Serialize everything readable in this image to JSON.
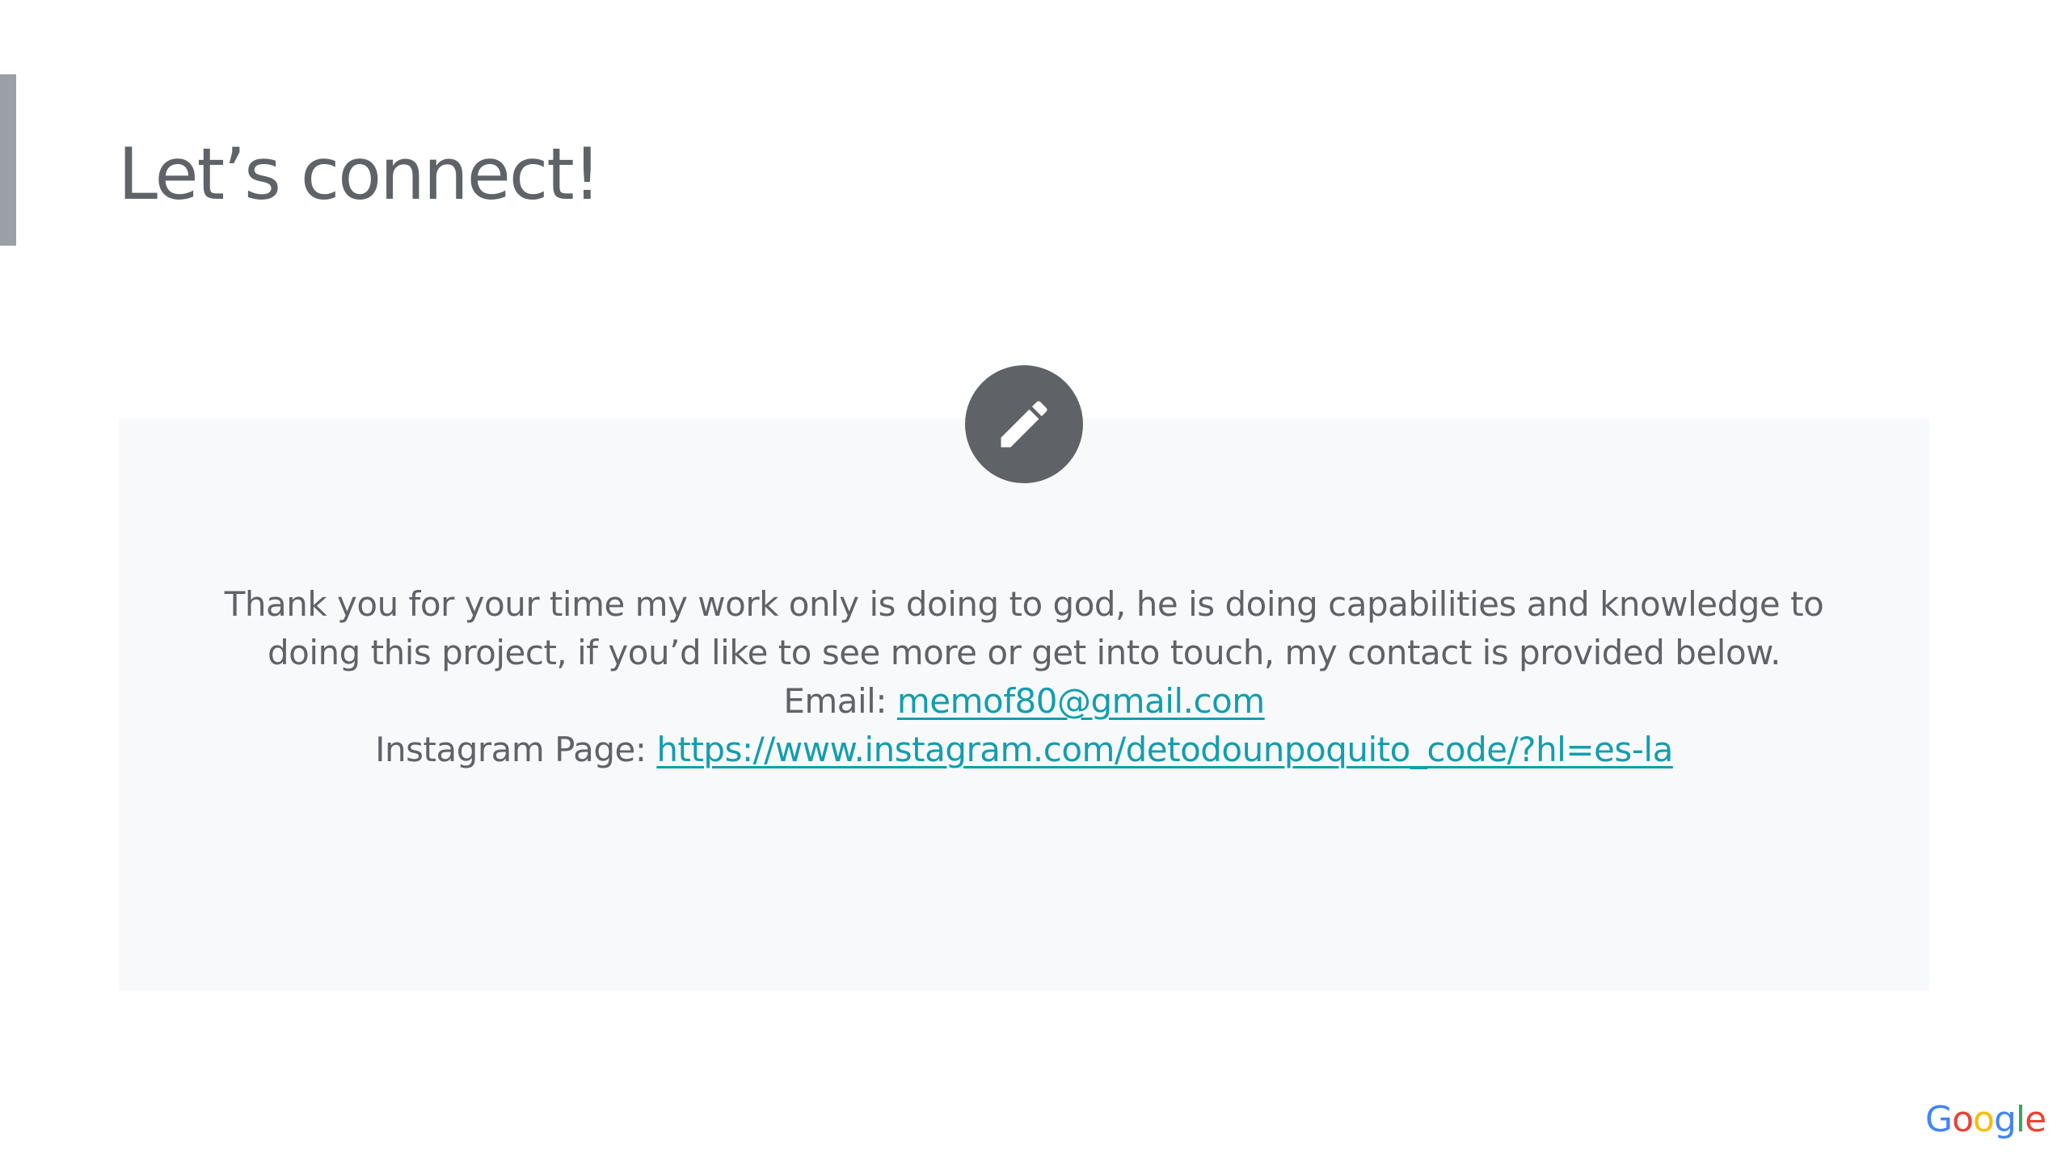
{
  "slide": {
    "title": "Let’s connect!",
    "body_line_1": "Thank you for your time my work only is doing to god, he is doing capabilities and knowledge to",
    "body_line_2": "doing this project, if you’d like to see more or get into touch, my contact is provided below.",
    "email_label": "Email: ",
    "email_value": "memof80@gmail.com",
    "instagram_label": "Instagram Page: ",
    "instagram_value": "https://www.instagram.com/detodounpoquito_code/?hl=es-la",
    "icon": "pencil-icon"
  },
  "logo": {
    "text": "Google",
    "letters": [
      "G",
      "o",
      "o",
      "g",
      "l",
      "e"
    ]
  },
  "colors": {
    "title": "#5f6368",
    "accent_bar": "#9aa0a6",
    "card_bg": "#f8f9fa",
    "icon_circle": "#5f6368",
    "link": "#129eaf"
  }
}
